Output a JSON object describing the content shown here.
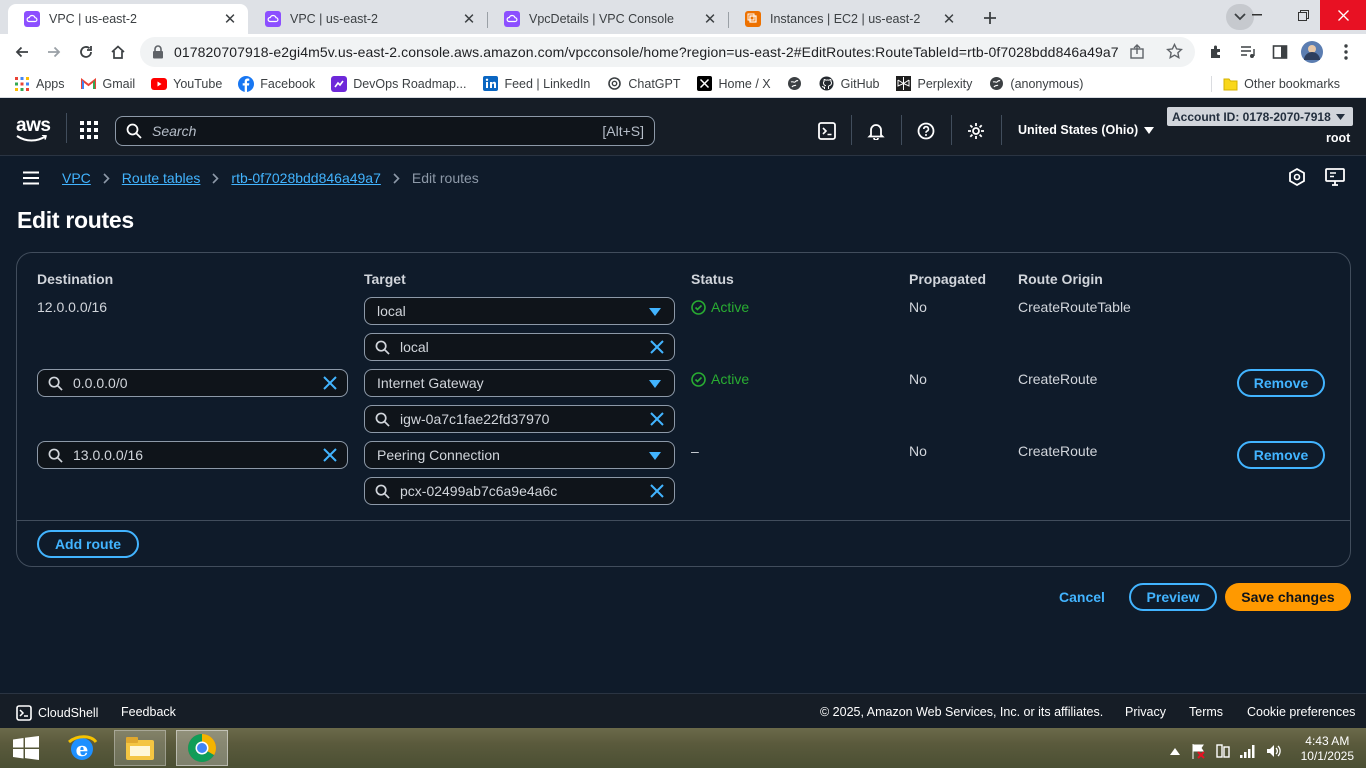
{
  "browser": {
    "tabs": [
      {
        "title": "VPC | us-east-2",
        "active": true,
        "favicon": "aws-vpc-icon",
        "color": "#8c4fff"
      },
      {
        "title": "VPC | us-east-2",
        "active": false,
        "favicon": "aws-vpc-icon",
        "color": "#8c4fff"
      },
      {
        "title": "VpcDetails | VPC Console",
        "active": false,
        "favicon": "aws-vpc-icon",
        "color": "#8c4fff"
      },
      {
        "title": "Instances | EC2 | us-east-2",
        "active": false,
        "favicon": "aws-ec2-icon",
        "color": "#ed7100"
      }
    ],
    "url": "017820707918-e2gi4m5v.us-east-2.console.aws.amazon.com/vpcconsole/home?region=us-east-2#EditRoutes:RouteTableId=rtb-0f7028bdd846a49a7",
    "bookmarks": [
      "Apps",
      "Gmail",
      "YouTube",
      "Facebook",
      "DevOps Roadmap...",
      "Feed | LinkedIn",
      "ChatGPT",
      "Home / X",
      "",
      "GitHub",
      "Perplexity",
      "(anonymous)"
    ],
    "other_bookmarks": "Other bookmarks"
  },
  "header": {
    "logo": "aws",
    "search_placeholder": "Search",
    "search_shortcut": "[Alt+S]",
    "region": "United States (Ohio)",
    "account": "Account ID: 0178-2070-7918",
    "user": "root"
  },
  "breadcrumb": {
    "vpc": "VPC",
    "route_tables": "Route tables",
    "route_table_id": "rtb-0f7028bdd846a49a7",
    "current": "Edit routes"
  },
  "page_title": "Edit routes",
  "table": {
    "headers": {
      "destination": "Destination",
      "target": "Target",
      "status": "Status",
      "propagated": "Propagated",
      "route_origin": "Route Origin"
    },
    "rows": [
      {
        "destination": "12.0.0.0/16",
        "target_type": "local",
        "target_value": "local",
        "status": "Active",
        "propagated": "No",
        "origin": "CreateRouteTable"
      },
      {
        "destination": "0.0.0.0/0",
        "target_type": "Internet Gateway",
        "target_value": "igw-0a7c1fae22fd37970",
        "status": "Active",
        "propagated": "No",
        "origin": "CreateRoute",
        "remove": "Remove"
      },
      {
        "destination": "13.0.0.0/16",
        "target_type": "Peering Connection",
        "target_value": "pcx-02499ab7c6a9e4a6c",
        "status": "–",
        "propagated": "No",
        "origin": "CreateRoute",
        "remove": "Remove"
      }
    ],
    "add_route": "Add route"
  },
  "actions": {
    "cancel": "Cancel",
    "preview": "Preview",
    "save": "Save changes"
  },
  "footer": {
    "cloudshell": "CloudShell",
    "feedback": "Feedback",
    "copyright": "© 2025, Amazon Web Services, Inc. or its affiliates.",
    "privacy": "Privacy",
    "terms": "Terms",
    "cookie": "Cookie preferences"
  },
  "taskbar": {
    "time": "4:43 AM",
    "date": "10/1/2025"
  },
  "colors": {
    "aws_bg": "#0f1b2a",
    "header_bg": "#161d26",
    "link": "#42b4ff",
    "active_status": "#29ad32",
    "primary_button": "#ff9900",
    "clear_icon": "#42b4ff"
  }
}
